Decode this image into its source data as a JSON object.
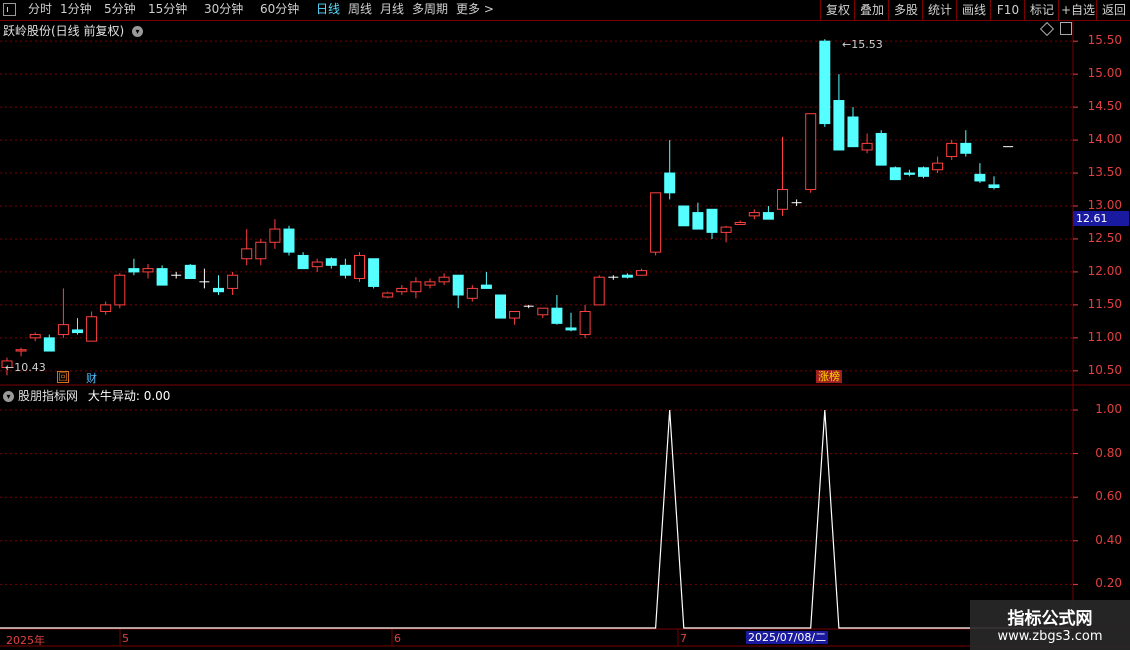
{
  "toolbar": {
    "periods": [
      "分时",
      "1分钟",
      "5分钟",
      "15分钟",
      "30分钟",
      "60分钟",
      "日线",
      "周线",
      "月线",
      "多周期",
      "更多 >"
    ],
    "active_period": "日线",
    "right_buttons": [
      "复权",
      "叠加",
      "多股",
      "统计",
      "画线",
      "F10",
      "标记",
      "+自选",
      "返回"
    ]
  },
  "main_panel": {
    "title": "跃岭股份(日线 前复权)",
    "high_label": "15.53",
    "low_label": "10.43",
    "current_price": "12.61",
    "price_axis": [
      "15.50",
      "15.00",
      "14.50",
      "14.00",
      "13.50",
      "13.00",
      "12.50",
      "12.00",
      "11.50",
      "11.00",
      "10.50"
    ],
    "tags": {
      "hui": "回",
      "cai": "财",
      "zhangbang": "涨榜"
    }
  },
  "indicator_panel": {
    "title": "股朋指标网",
    "indicator_name": "大牛异动:",
    "indicator_value": "0.00",
    "axis": [
      "1.00",
      "0.80",
      "0.60",
      "0.40",
      "0.20"
    ]
  },
  "date_axis": {
    "labels": [
      "2025年",
      "5",
      "6",
      "7"
    ],
    "cursor_date": "2025/07/08/二"
  },
  "watermark": {
    "line1": "指标公式网",
    "line2": "www.zbgs3.com"
  },
  "colors": {
    "up": "#ff4040",
    "down": "#55ffff",
    "grid": "#7a0000",
    "signal": "#ffffff"
  },
  "chart_data": {
    "type": "candlestick",
    "ohlc": [
      [
        10.55,
        10.7,
        10.43,
        10.65
      ],
      [
        10.8,
        10.85,
        10.72,
        10.82
      ],
      [
        11.0,
        11.08,
        10.95,
        11.05
      ],
      [
        11.0,
        11.05,
        10.8,
        10.8
      ],
      [
        11.05,
        11.75,
        11.0,
        11.2
      ],
      [
        11.12,
        11.3,
        11.05,
        11.08
      ],
      [
        10.95,
        11.4,
        10.95,
        11.32
      ],
      [
        11.4,
        11.55,
        11.35,
        11.5
      ],
      [
        11.5,
        11.98,
        11.45,
        11.95
      ],
      [
        12.05,
        12.2,
        11.95,
        12.0
      ],
      [
        12.0,
        12.12,
        11.9,
        12.05
      ],
      [
        12.05,
        12.1,
        11.8,
        11.8
      ],
      [
        11.95,
        12.0,
        11.9,
        11.95
      ],
      [
        12.1,
        12.12,
        11.9,
        11.9
      ],
      [
        11.85,
        12.05,
        11.75,
        11.85
      ],
      [
        11.75,
        11.95,
        11.65,
        11.7
      ],
      [
        11.75,
        12.0,
        11.65,
        11.95
      ],
      [
        12.2,
        12.65,
        12.1,
        12.35
      ],
      [
        12.2,
        12.5,
        12.1,
        12.45
      ],
      [
        12.45,
        12.8,
        12.35,
        12.65
      ],
      [
        12.65,
        12.7,
        12.25,
        12.3
      ],
      [
        12.25,
        12.3,
        12.05,
        12.05
      ],
      [
        12.08,
        12.2,
        12.0,
        12.15
      ],
      [
        12.2,
        12.22,
        12.05,
        12.1
      ],
      [
        12.1,
        12.2,
        11.9,
        11.95
      ],
      [
        11.9,
        12.3,
        11.85,
        12.25
      ],
      [
        12.2,
        12.2,
        11.75,
        11.78
      ],
      [
        11.62,
        11.7,
        11.6,
        11.68
      ],
      [
        11.7,
        11.8,
        11.65,
        11.75
      ],
      [
        11.7,
        11.92,
        11.6,
        11.85
      ],
      [
        11.8,
        11.9,
        11.75,
        11.85
      ],
      [
        11.85,
        11.98,
        11.8,
        11.92
      ],
      [
        11.95,
        11.95,
        11.45,
        11.65
      ],
      [
        11.6,
        11.8,
        11.55,
        11.75
      ],
      [
        11.8,
        12.0,
        11.75,
        11.75
      ],
      [
        11.65,
        11.65,
        11.3,
        11.3
      ],
      [
        11.3,
        11.4,
        11.2,
        11.4
      ],
      [
        11.48,
        11.5,
        11.45,
        11.48
      ],
      [
        11.35,
        11.45,
        11.3,
        11.45
      ],
      [
        11.45,
        11.65,
        11.2,
        11.22
      ],
      [
        11.15,
        11.38,
        11.1,
        11.12
      ],
      [
        11.05,
        11.5,
        11.0,
        11.4
      ],
      [
        11.5,
        11.95,
        11.5,
        11.92
      ],
      [
        11.92,
        11.95,
        11.88,
        11.92
      ],
      [
        11.95,
        11.98,
        11.9,
        11.92
      ],
      [
        11.95,
        12.05,
        11.95,
        12.02
      ],
      [
        12.3,
        13.2,
        12.25,
        13.2
      ],
      [
        13.5,
        14.0,
        13.1,
        13.2
      ],
      [
        13.0,
        13.0,
        12.7,
        12.7
      ],
      [
        12.9,
        13.05,
        12.7,
        12.65
      ],
      [
        12.95,
        12.95,
        12.5,
        12.6
      ],
      [
        12.6,
        12.7,
        12.45,
        12.68
      ],
      [
        12.72,
        12.78,
        12.72,
        12.75
      ],
      [
        12.85,
        12.95,
        12.8,
        12.9
      ],
      [
        12.9,
        13.0,
        12.8,
        12.8
      ],
      [
        12.95,
        14.05,
        12.85,
        13.25
      ],
      [
        13.05,
        13.1,
        13.0,
        13.05
      ],
      [
        13.25,
        14.4,
        13.2,
        14.4
      ],
      [
        15.5,
        15.53,
        14.2,
        14.25
      ],
      [
        14.6,
        15.0,
        13.85,
        13.85
      ],
      [
        14.35,
        14.5,
        13.9,
        13.9
      ],
      [
        13.85,
        14.1,
        13.8,
        13.95
      ],
      [
        14.1,
        14.15,
        13.62,
        13.62
      ],
      [
        13.58,
        13.6,
        13.4,
        13.4
      ],
      [
        13.5,
        13.55,
        13.45,
        13.48
      ],
      [
        13.58,
        13.6,
        13.42,
        13.45
      ],
      [
        13.55,
        13.75,
        13.5,
        13.65
      ],
      [
        13.75,
        14.0,
        13.7,
        13.95
      ],
      [
        13.95,
        14.15,
        13.75,
        13.8
      ],
      [
        13.48,
        13.65,
        13.35,
        13.38
      ],
      [
        13.32,
        13.45,
        13.25,
        13.28
      ],
      [
        13.9,
        13.9,
        13.9,
        13.9
      ]
    ],
    "signal": [
      0,
      0,
      0,
      0,
      0,
      0,
      0,
      0,
      0,
      0,
      0,
      0,
      0,
      0,
      0,
      0,
      0,
      0,
      0,
      0,
      0,
      0,
      0,
      0,
      0,
      0,
      0,
      0,
      0,
      0,
      0,
      0,
      0,
      0,
      0,
      0,
      0,
      0,
      0,
      0,
      0,
      0,
      0,
      0,
      0,
      0,
      0,
      1,
      0,
      0,
      0,
      0,
      0,
      0,
      0,
      0,
      0,
      0,
      1,
      0,
      0,
      0,
      0,
      0,
      0,
      0,
      0,
      0,
      0,
      0,
      0,
      0
    ],
    "ylim": [
      10.3,
      15.7
    ],
    "signal_ylim": [
      0,
      1
    ]
  }
}
